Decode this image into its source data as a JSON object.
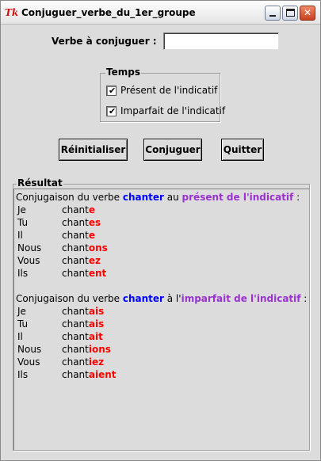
{
  "window": {
    "title": "Conjuguer_verbe_du_1er_groupe",
    "logo": "Tk"
  },
  "form": {
    "verbe_label": "Verbe à conjuguer :",
    "verbe_value": ""
  },
  "temps": {
    "legend": "Temps",
    "options": [
      {
        "label": "Présent de l'indicatif",
        "checked": true,
        "mark": "✔"
      },
      {
        "label": "Imparfait de l'indicatif",
        "checked": true,
        "mark": "✔"
      }
    ]
  },
  "buttons": {
    "reinit": "Réinitialiser",
    "conjuguer": "Conjuguer",
    "quitter": "Quitter"
  },
  "result": {
    "legend": "Résultat",
    "verb_stem": "chant",
    "present": {
      "intro_prefix": "Conjugaison du verbe ",
      "verb": "chanter",
      "intro_mid": " au ",
      "tense": "présent de l'indicatif",
      "intro_suffix": " :",
      "rows": [
        {
          "pronoun": "Je",
          "ending": "e"
        },
        {
          "pronoun": "Tu",
          "ending": "es"
        },
        {
          "pronoun": "Il",
          "ending": "e"
        },
        {
          "pronoun": "Nous",
          "ending": "ons"
        },
        {
          "pronoun": "Vous",
          "ending": "ez"
        },
        {
          "pronoun": "Ils",
          "ending": "ent"
        }
      ]
    },
    "imparfait": {
      "intro_prefix": "Conjugaison du verbe ",
      "verb": "chanter",
      "intro_mid": " à l'",
      "tense": "imparfait de l'indicatif",
      "intro_suffix": " :",
      "rows": [
        {
          "pronoun": "Je",
          "ending": "ais"
        },
        {
          "pronoun": "Tu",
          "ending": "ais"
        },
        {
          "pronoun": "Il",
          "ending": "ait"
        },
        {
          "pronoun": "Nous",
          "ending": "ions"
        },
        {
          "pronoun": "Vous",
          "ending": "iez"
        },
        {
          "pronoun": "Ils",
          "ending": "aient"
        }
      ]
    }
  }
}
